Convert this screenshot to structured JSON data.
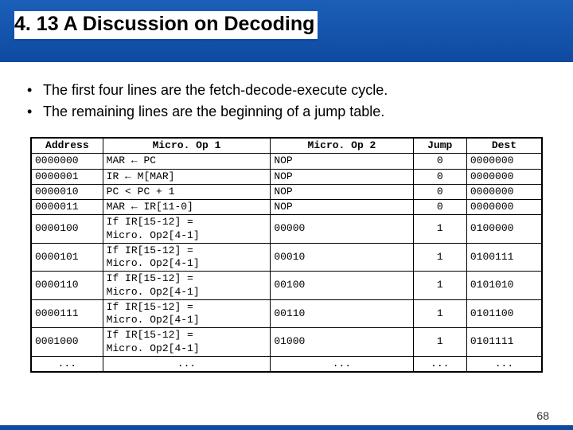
{
  "title": "4. 13 A Discussion on Decoding",
  "bullets": [
    "The first four lines are the fetch-decode-execute cycle.",
    "The remaining lines are the beginning of a jump table."
  ],
  "table": {
    "headers": [
      "Address",
      "Micro. Op 1",
      "Micro. Op 2",
      "Jump",
      "Dest"
    ],
    "rows": [
      {
        "addr": "0000000",
        "op1": "MAR ← PC",
        "op2": "NOP",
        "jump": "0",
        "dest": "0000000"
      },
      {
        "addr": "0000001",
        "op1": "IR ← M[MAR]",
        "op2": "NOP",
        "jump": "0",
        "dest": "0000000"
      },
      {
        "addr": "0000010",
        "op1": "PC < PC + 1",
        "op2": "NOP",
        "jump": "0",
        "dest": "0000000"
      },
      {
        "addr": "0000011",
        "op1": "MAR ← IR[11-0]",
        "op2": "NOP",
        "jump": "0",
        "dest": "0000000"
      },
      {
        "addr": "0000100",
        "op1": "If IR[15-12] =\nMicro. Op2[4-1]",
        "op2": "00000",
        "jump": "1",
        "dest": "0100000"
      },
      {
        "addr": "0000101",
        "op1": "If IR[15-12] =\nMicro. Op2[4-1]",
        "op2": "00010",
        "jump": "1",
        "dest": "0100111"
      },
      {
        "addr": "0000110",
        "op1": "If IR[15-12] =\nMicro. Op2[4-1]",
        "op2": "00100",
        "jump": "1",
        "dest": "0101010"
      },
      {
        "addr": "0000111",
        "op1": "If IR[15-12] =\nMicro. Op2[4-1]",
        "op2": "00110",
        "jump": "1",
        "dest": "0101100"
      },
      {
        "addr": "0001000",
        "op1": "If IR[15-12] =\nMicro. Op2[4-1]",
        "op2": "01000",
        "jump": "1",
        "dest": "0101111"
      },
      {
        "addr": "...",
        "op1": "...",
        "op2": "...",
        "jump": "...",
        "dest": "..."
      }
    ]
  },
  "page_number": "68"
}
